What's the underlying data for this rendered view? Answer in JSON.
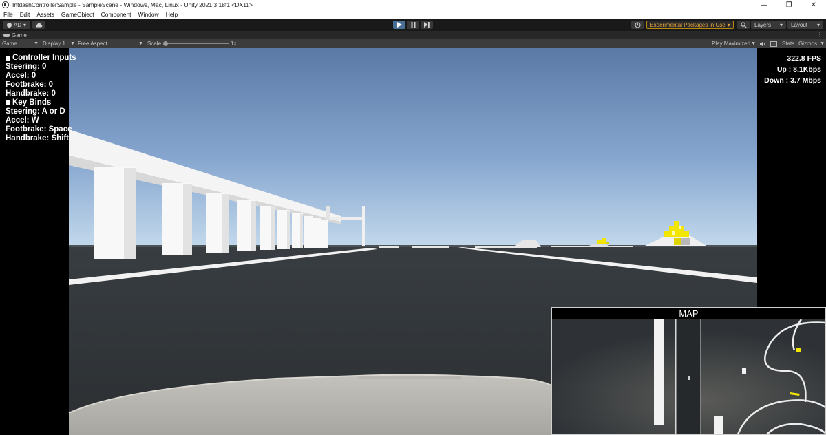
{
  "window": {
    "title": "IntdashControllerSample - SampleScene - Windows, Mac, Linux - Unity 2021.3.18f1 <DX11>",
    "controls": {
      "minimize": "—",
      "maximize": "❐",
      "close": "✕"
    }
  },
  "menu": [
    "File",
    "Edit",
    "Assets",
    "GameObject",
    "Component",
    "Window",
    "Help"
  ],
  "toolbar": {
    "account_label": "AD",
    "experimental_packages": "Experimental Packages In Use",
    "layers_label": "Layers",
    "layout_label": "Layout",
    "play_state": "playing",
    "icons": [
      "account-icon",
      "cloud-icon",
      "play-icon",
      "pause-icon",
      "step-icon",
      "history-icon",
      "search-icon"
    ]
  },
  "tab": {
    "label": "Game"
  },
  "game_controls": {
    "view_mode": "Game",
    "display": "Display 1",
    "aspect": "Free Aspect",
    "scale_label": "Scale",
    "scale_value": "1x",
    "play_mode": "Play Maximized",
    "stats_label": "Stats",
    "gizmos_label": "Gizmos"
  },
  "hud": {
    "controller_inputs_title": "Controller Inputs",
    "steering": "Steering: 0",
    "accel": "Accel: 0",
    "footbrake": "Footbrake: 0",
    "handbrake": "Handbrake: 0",
    "key_binds_title": "Key Binds",
    "steering_key": "Steering: A or D",
    "accel_key": "Accel: W",
    "footbrake_key": "Footbrake: Space",
    "handbrake_key": "Handbrake: Shift",
    "fps": "322.8 FPS",
    "upload": "Up : 8.1Kbps",
    "download": "Down : 3.7 Mbps"
  },
  "minimap": {
    "title": "MAP"
  },
  "colors": {
    "accent_play": "#4a6f96",
    "experimental_border": "#b8870d",
    "experimental_text": "#e8a83a",
    "sky_top": "#5b79a5",
    "sky_horizon": "#c3d9ec",
    "ground": "#2f3437",
    "marker_yellow": "#f2e600"
  }
}
